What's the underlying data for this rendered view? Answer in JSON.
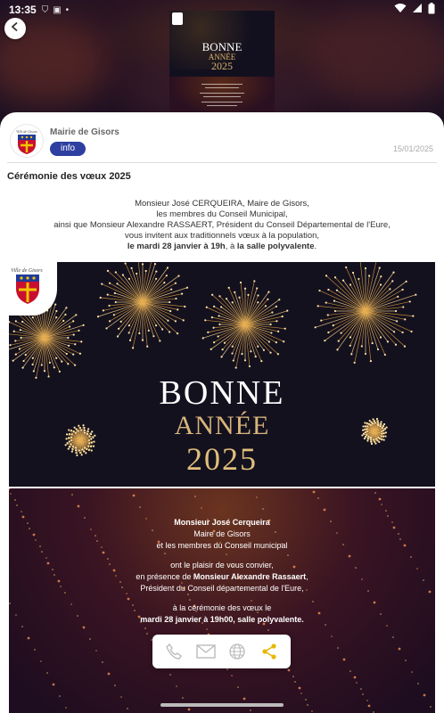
{
  "status_bar": {
    "time": "13:35"
  },
  "header": {
    "back_icon": "arrow-left-icon",
    "thumbnail": {
      "bonne": "BONNE",
      "annee": "ANNÉE",
      "year": "2025"
    }
  },
  "post": {
    "org_name": "Mairie de Gisors",
    "tag": "info",
    "date": "15/01/2025",
    "title": "Cérémonie des vœux 2025",
    "body": [
      "Monsieur José CERQUEIRA, Maire de Gisors,",
      "les membres du Conseil Municipal,",
      "ainsi que Monsieur Alexandre RASSAERT, Président du Conseil Départemental de l'Eure,",
      "vous invitent aux traditionnels vœux à la population,"
    ],
    "body_last_bold_1": "le mardi 28 janvier à 19h",
    "body_last_sep": ", à ",
    "body_last_bold_2": "la salle polyvalente",
    "body_last_end": "."
  },
  "poster": {
    "bonne": "BONNE",
    "annee": "ANNÉE",
    "year": "2025",
    "crest_label": "Ville de Gisors",
    "lines": {
      "l1": "Monsieur José Cerqueira",
      "l2": "Maire de Gisors",
      "l3": "et les membres du Conseil municipal",
      "l4": "ont le plaisir de vous convier,",
      "l5_pre": "en présence de ",
      "l5_bold": "Monsieur Alexandre Rassaert",
      "l5_post": ",",
      "l6": "Président du Conseil départemental de l'Eure,",
      "l7": "à la cérémonie des vœux le",
      "l8": "mardi 28 janvier à 19h00, salle polyvalente."
    }
  },
  "actions": {
    "icons": [
      "phone-icon",
      "mail-icon",
      "web-icon",
      "share-icon"
    ],
    "share_color": "#e6b800",
    "inactive_color": "#bbbbbb"
  },
  "colors": {
    "tag_bg": "#2d3fa0",
    "gold": "#d7b57a"
  }
}
